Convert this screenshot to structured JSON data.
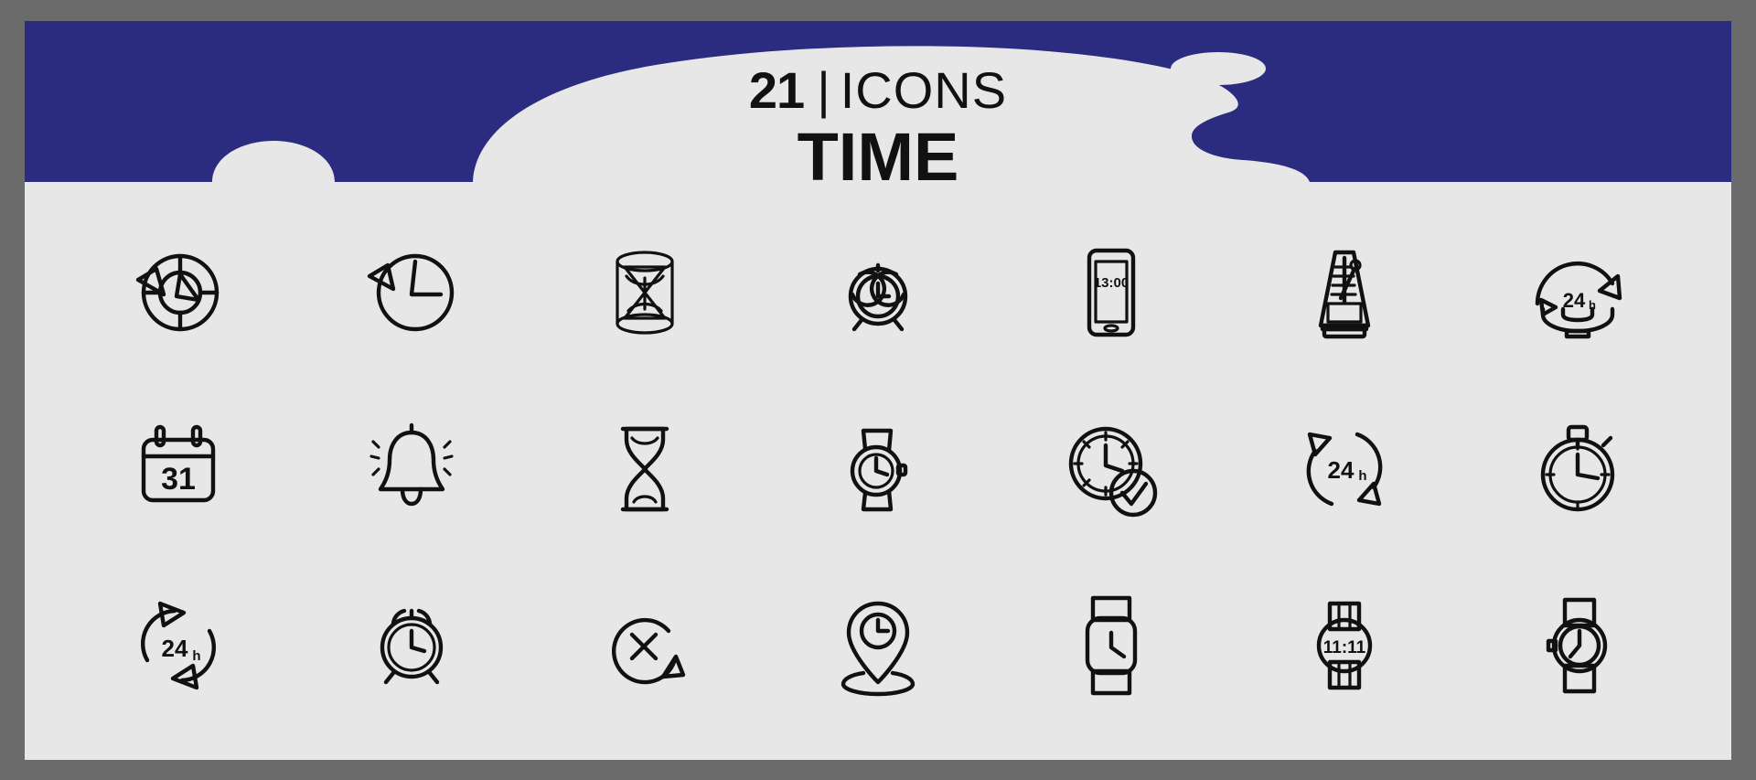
{
  "poster": {
    "background_color": "#e7e7e7",
    "frame_color": "#6b6b6b"
  },
  "header": {
    "background_color": "#2b2b7f",
    "blob_color": "#e7e7e7",
    "count": "21",
    "count_label": "ICONS",
    "separator": "|",
    "title": "TIME"
  },
  "grid": {
    "columns": 7,
    "rows": 3,
    "total": 21,
    "icons": [
      {
        "name": "clock-counterclockwise-history-icon",
        "label": "Clock with counterclockwise arrow"
      },
      {
        "name": "clock-rewind-arrow-icon",
        "label": "Clock with rewind arrow"
      },
      {
        "name": "hourglass-cylinder-icon",
        "label": "Hourglass in cylinder"
      },
      {
        "name": "alarm-clock-bells-icon",
        "label": "Alarm clock with bells"
      },
      {
        "name": "smartphone-time-icon",
        "label": "Smartphone showing time",
        "screen_text": "13:00"
      },
      {
        "name": "metronome-icon",
        "label": "Metronome"
      },
      {
        "name": "support-24h-phone-icon",
        "label": "24h support phone",
        "badge_text": "24",
        "badge_suffix": "h"
      },
      {
        "name": "calendar-date-icon",
        "label": "Calendar",
        "date_text": "31"
      },
      {
        "name": "ringing-bell-icon",
        "label": "Ringing bell"
      },
      {
        "name": "hourglass-sandglass-icon",
        "label": "Hourglass sand timer"
      },
      {
        "name": "wristwatch-square-icon",
        "label": "Wristwatch"
      },
      {
        "name": "clock-check-approved-icon",
        "label": "Clock with checkmark"
      },
      {
        "name": "rotation-24h-arrows-icon",
        "label": "24h circular arrows",
        "badge_text": "24",
        "badge_suffix": "h"
      },
      {
        "name": "stopwatch-icon",
        "label": "Stopwatch"
      },
      {
        "name": "refresh-24h-arrows-icon",
        "label": "24h refresh arrows",
        "badge_text": "24",
        "badge_suffix": "h"
      },
      {
        "name": "alarm-clock-round-icon",
        "label": "Round alarm clock"
      },
      {
        "name": "cancel-time-arrow-icon",
        "label": "Cancel time with arrow"
      },
      {
        "name": "location-pin-clock-icon",
        "label": "Location pin with clock"
      },
      {
        "name": "smartwatch-icon",
        "label": "Smartwatch"
      },
      {
        "name": "digital-watch-icon",
        "label": "Digital wristwatch",
        "screen_text": "11:11"
      },
      {
        "name": "analog-wristwatch-icon",
        "label": "Analog wristwatch"
      }
    ]
  }
}
